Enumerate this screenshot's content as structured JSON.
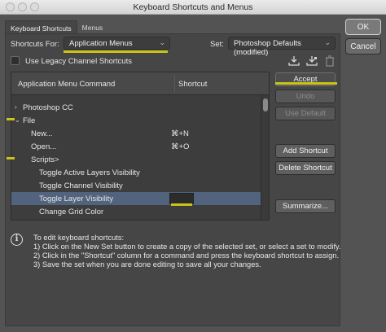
{
  "window": {
    "title": "Keyboard Shortcuts and Menus"
  },
  "tabs": [
    {
      "label": "Keyboard Shortcuts"
    },
    {
      "label": "Menus"
    }
  ],
  "shortcuts_for": {
    "label": "Shortcuts For:",
    "value": "Application Menus"
  },
  "set": {
    "label": "Set:",
    "value": "Photoshop Defaults (modified)"
  },
  "legacy": {
    "label": "Use Legacy Channel Shortcuts",
    "checked": false
  },
  "table": {
    "headers": {
      "command": "Application Menu Command",
      "shortcut": "Shortcut"
    },
    "rows": [
      {
        "label": "Photoshop CC",
        "shortcut": "",
        "disclosure": "›"
      },
      {
        "label": "File",
        "shortcut": "",
        "disclosure": "⌄"
      },
      {
        "label": "New...",
        "shortcut": "⌘+N"
      },
      {
        "label": "Open...",
        "shortcut": "⌘+O"
      },
      {
        "label": "Scripts>",
        "shortcut": ""
      },
      {
        "label": "Toggle Active Layers Visibility",
        "shortcut": ""
      },
      {
        "label": "Toggle Channel Visibility",
        "shortcut": ""
      },
      {
        "label": "Toggle Layer Visibility",
        "shortcut": "",
        "selected": true
      },
      {
        "label": "Change Grid Color",
        "shortcut": ""
      }
    ]
  },
  "buttons": {
    "accept": "Accept",
    "undo": "Undo",
    "use_default": "Use Default",
    "add_shortcut": "Add Shortcut",
    "delete_shortcut": "Delete Shortcut",
    "summarize": "Summarize...",
    "ok": "OK",
    "cancel": "Cancel"
  },
  "info": {
    "lines": [
      "To edit keyboard shortcuts:",
      "1) Click on the New Set button to create a copy of the selected set, or select a set to modify.",
      "2) Click in the \"Shortcut\" column for a command and press the keyboard shortcut to assign.",
      "3) Save the set when you are done editing to save all your changes."
    ]
  },
  "icons": [
    "save-set-icon",
    "save-as-new-set-icon",
    "delete-set-icon",
    "info-icon"
  ],
  "colors": {
    "highlight": "#c9c31a",
    "selection": "#52637d",
    "panel": "#464646"
  }
}
